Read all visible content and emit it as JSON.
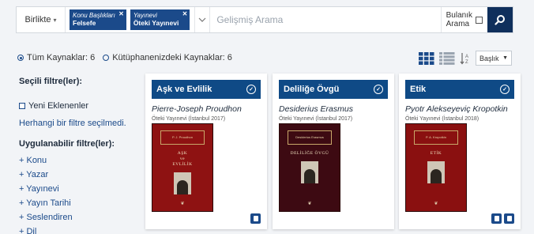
{
  "search": {
    "scope_label": "Birlikte",
    "chips": [
      {
        "key": "Konu Başlıkları",
        "value": "Felsefe"
      },
      {
        "key": "Yayınevi",
        "value": "Öteki Yayınevi"
      }
    ],
    "placeholder": "Gelişmiş Arama",
    "fuzzy_label_line1": "Bulanık",
    "fuzzy_label_line2": "Arama"
  },
  "sources": {
    "all_label": "Tüm Kaynaklar: 6",
    "library_label": "Kütüphanenizdeki Kaynaklar: 6",
    "selected": "all"
  },
  "view": {
    "sort_value": "Başlık",
    "mode": "grid"
  },
  "sidebar": {
    "selected_filters_title": "Seçili filtre(ler):",
    "new_items_label": "Yeni Eklenenler",
    "no_filter_text": "Herhangi bir filtre seçilmedi.",
    "available_filters_title": "Uygulanabilir filtre(ler):",
    "filters": [
      "+ Konu",
      "+ Yazar",
      "+ Yayınevi",
      "+ Yayın Tarihi",
      "+ Seslendiren",
      "+ Dil"
    ]
  },
  "cards": [
    {
      "title": "Aşk ve Evlilik",
      "author": "Pierre-Joseph Proudhon",
      "publisher": "Öteki Yayınevi (İstanbul 2017)",
      "cover_title_line1": "AŞK",
      "cover_title_line2": "ve",
      "cover_title_line3": "EVLİLİK",
      "cover_series": "P. J. Proudhon",
      "cover_color": "#8e1212"
    },
    {
      "title": "Deliliğe Övgü",
      "author": "Desiderius Erasmus",
      "publisher": "Öteki Yayınevi (İstanbul 2017)",
      "cover_title_line1": "DELİLİĞE ÖVGÜ",
      "cover_title_line2": "",
      "cover_title_line3": "",
      "cover_series": "Desiderius Erasmus",
      "cover_color": "#3d0a12"
    },
    {
      "title": "Etik",
      "author": "Pyotr Alekseyeviç Kropotkin",
      "publisher": "Öteki Yayınevi (İstanbul 2018)",
      "cover_title_line1": "ETİK",
      "cover_title_line2": "",
      "cover_title_line3": "",
      "cover_series": "P. A. Kropotkin",
      "cover_color": "#8a1010"
    }
  ],
  "colors": {
    "primary": "#0f4a86",
    "dark": "#0f2f5c",
    "background": "#f2f4f7"
  }
}
